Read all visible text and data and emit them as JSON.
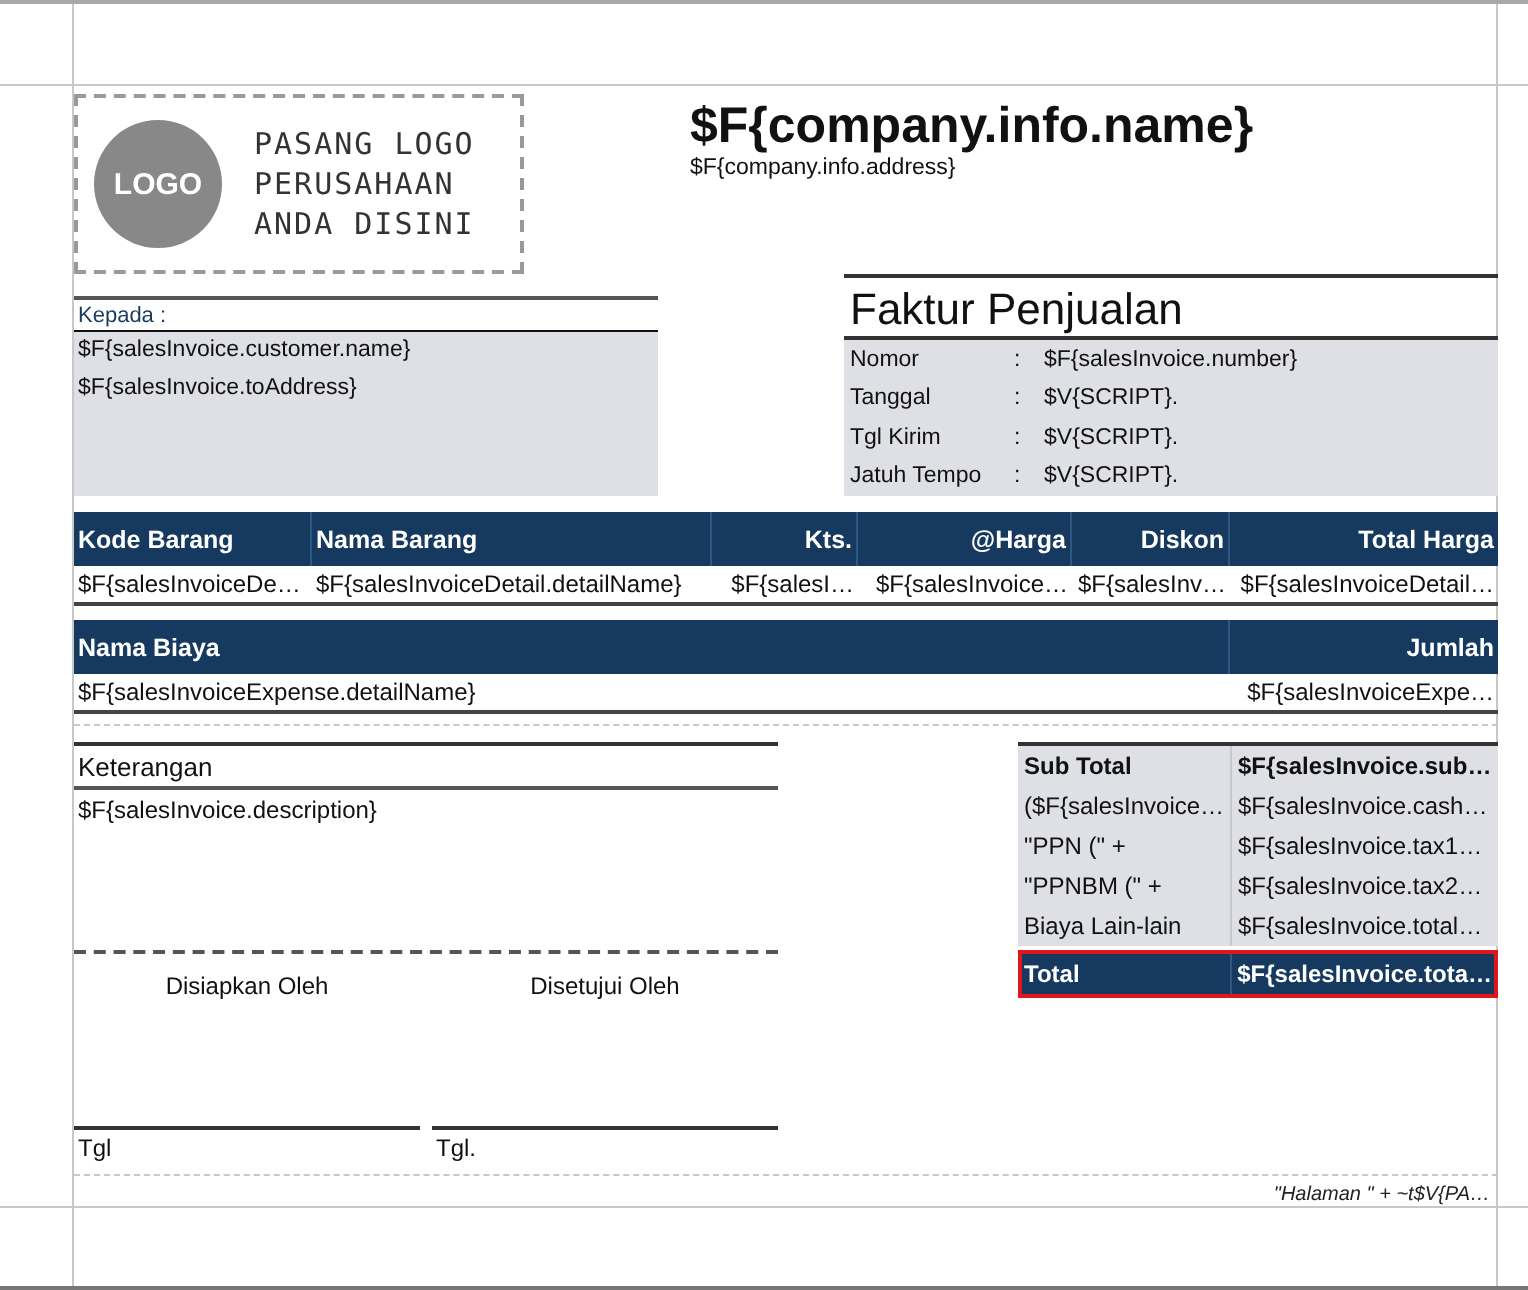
{
  "logo": {
    "badge": "LOGO",
    "text_lines": [
      "PASANG LOGO",
      "PERUSAHAAN",
      "ANDA DISINI"
    ]
  },
  "company": {
    "name": "$F{company.info.name}",
    "address": "$F{company.info.address}"
  },
  "recipient": {
    "label": "Kepada :",
    "lines": [
      "$F{salesInvoice.customer.name}",
      "$F{salesInvoice.toAddress}"
    ]
  },
  "invoice": {
    "title": "Faktur Penjualan",
    "fields": [
      {
        "label": "Nomor",
        "separator": ":",
        "value": "$F{salesInvoice.number}"
      },
      {
        "label": "Tanggal",
        "separator": ":",
        "value": "$V{SCRIPT}."
      },
      {
        "label": "Tgl Kirim",
        "separator": ":",
        "value": "$V{SCRIPT}."
      },
      {
        "label": "Jatuh Tempo",
        "separator": ":",
        "value": "$V{SCRIPT}."
      }
    ]
  },
  "items_table": {
    "columns": [
      {
        "label": "Kode Barang",
        "kind": "text"
      },
      {
        "label": "Nama Barang",
        "kind": "text"
      },
      {
        "label": "Kts.",
        "kind": "numeric"
      },
      {
        "label": "@Harga",
        "kind": "numeric"
      },
      {
        "label": "Diskon",
        "kind": "numeric"
      },
      {
        "label": "Total Harga",
        "kind": "numeric"
      }
    ],
    "row": [
      "$F{salesInvoiceDe…",
      "$F{salesInvoiceDetail.detailName}",
      "$F{salesI…",
      "$F{salesInvoice…",
      "$F{salesInv…",
      "$F{salesInvoiceDetail…"
    ]
  },
  "expenses_table": {
    "columns": [
      {
        "label": "Nama Biaya",
        "kind": "text"
      },
      {
        "label": "Jumlah",
        "kind": "numeric"
      }
    ],
    "row": [
      "$F{salesInvoiceExpense.detailName}",
      "$F{salesInvoiceExpe…"
    ]
  },
  "notes": {
    "title": "Keterangan",
    "value": "$F{salesInvoice.description}"
  },
  "signatures": [
    {
      "title": "Disiapkan Oleh",
      "date_label": "Tgl"
    },
    {
      "title": "Disetujui Oleh",
      "date_label": "Tgl."
    }
  ],
  "summary": {
    "rows": [
      {
        "kind": "bold",
        "label": "Sub Total",
        "value": "$F{salesInvoice.sub…",
        "selected": false
      },
      {
        "kind": "normal",
        "label": "($F{salesInvoice…",
        "value": "$F{salesInvoice.cash…",
        "selected": false
      },
      {
        "kind": "normal",
        "label": "\"PPN (\" +",
        "value": "$F{salesInvoice.tax1…",
        "selected": false
      },
      {
        "kind": "normal",
        "label": "\"PPNBM (\" +",
        "value": "$F{salesInvoice.tax2…",
        "selected": false
      },
      {
        "kind": "normal",
        "label": "Biaya Lain-lain",
        "value": "$F{salesInvoice.total…",
        "selected": false
      },
      {
        "kind": "total",
        "label": "Total",
        "value": "$F{salesInvoice.tota…",
        "selected": true
      }
    ]
  },
  "footer": {
    "page_number": "\"Halaman \" +  ~t$V{PA…"
  }
}
